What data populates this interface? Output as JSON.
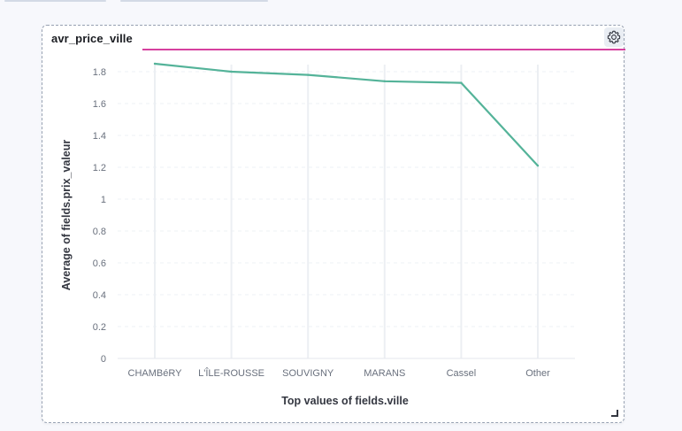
{
  "panel": {
    "title": "avr_price_ville",
    "accent_color": "#d6409f",
    "settings_icon": "gear-icon"
  },
  "chart_data": {
    "type": "line",
    "categories": [
      "CHAMBéRY",
      "L'ÎLE-ROUSSE",
      "SOUVIGNY",
      "MARANS",
      "Cassel",
      "Other"
    ],
    "series": [
      {
        "values": [
          1.85,
          1.8,
          1.78,
          1.74,
          1.73,
          1.21
        ],
        "color": "#54b399"
      }
    ],
    "xlabel": "Top values of fields.ville",
    "ylabel": "Average of fields.prix_valeur",
    "yticks": [
      "0",
      "0.2",
      "0.4",
      "0.6",
      "0.8",
      "1",
      "1.2",
      "1.4",
      "1.6",
      "1.8"
    ],
    "ylim": [
      0,
      1.8
    ],
    "grid": true
  }
}
